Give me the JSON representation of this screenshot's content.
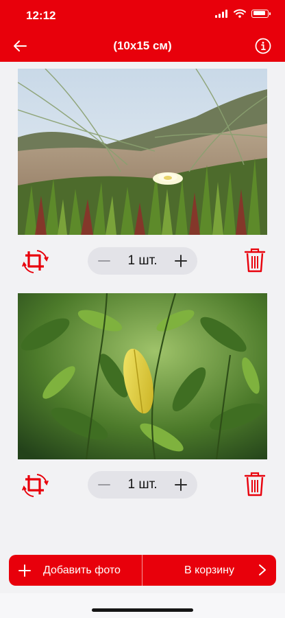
{
  "status_bar": {
    "time": "12:12"
  },
  "nav": {
    "title": "(10x15 см)",
    "back_icon": "arrow-left-icon",
    "info_icon": "info-circle-icon"
  },
  "colors": {
    "brand_red": "#e8000b",
    "background": "#f2f2f4",
    "stepper_bg": "#e3e3e8"
  },
  "photos": [
    {
      "id": 1,
      "quantity_label": "1 шт.",
      "icons": [
        "crop-rotate-icon",
        "minus-icon",
        "plus-icon",
        "trash-icon"
      ]
    },
    {
      "id": 2,
      "quantity_label": "1 шт.",
      "icons": [
        "crop-rotate-icon",
        "minus-icon",
        "plus-icon",
        "trash-icon"
      ]
    }
  ],
  "bottom_bar": {
    "add_photo_label": "Добавить фото",
    "cart_label": "В корзину"
  }
}
